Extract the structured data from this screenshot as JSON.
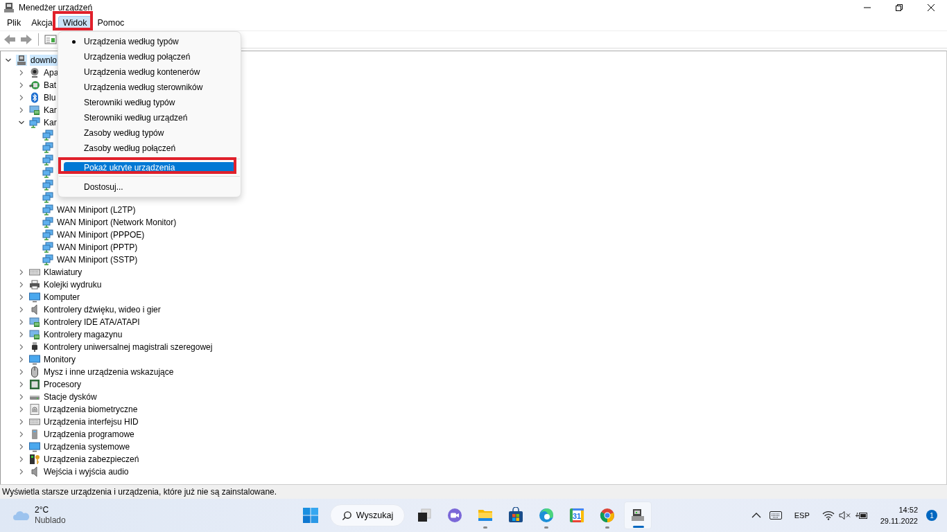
{
  "window": {
    "title": "Menedżer urządzeń"
  },
  "menubar": [
    {
      "label": "Plik",
      "selected": false,
      "marked_red": false
    },
    {
      "label": "Akcja",
      "selected": false,
      "marked_red": false
    },
    {
      "label": "Widok",
      "selected": true,
      "marked_red": true
    },
    {
      "label": "Pomoc",
      "selected": false,
      "marked_red": false
    }
  ],
  "view_menu": [
    {
      "kind": "option",
      "label": "Urządzenia według typów",
      "checked": true,
      "hovered": false,
      "marked_red": false
    },
    {
      "kind": "option",
      "label": "Urządzenia według połączeń",
      "checked": false,
      "hovered": false,
      "marked_red": false
    },
    {
      "kind": "option",
      "label": "Urządzenia według kontenerów",
      "checked": false,
      "hovered": false,
      "marked_red": false
    },
    {
      "kind": "option",
      "label": "Urządzenia według sterowników",
      "checked": false,
      "hovered": false,
      "marked_red": false
    },
    {
      "kind": "option",
      "label": "Sterowniki według typów",
      "checked": false,
      "hovered": false,
      "marked_red": false
    },
    {
      "kind": "option",
      "label": "Sterowniki według urządzeń",
      "checked": false,
      "hovered": false,
      "marked_red": false
    },
    {
      "kind": "option",
      "label": "Zasoby według typów",
      "checked": false,
      "hovered": false,
      "marked_red": false
    },
    {
      "kind": "option",
      "label": "Zasoby według połączeń",
      "checked": false,
      "hovered": false,
      "marked_red": false
    },
    {
      "kind": "separator"
    },
    {
      "kind": "option",
      "label": "Pokaż ukryte urządzenia",
      "checked": false,
      "hovered": true,
      "marked_red": true
    },
    {
      "kind": "separator"
    },
    {
      "kind": "option",
      "label": "Dostosuj...",
      "checked": false,
      "hovered": false,
      "marked_red": false
    }
  ],
  "tree": {
    "label": "downlo",
    "kind": "computer",
    "expanded": true,
    "selected": true,
    "children": [
      {
        "label": "Apa",
        "kind": "camera",
        "expanded": false,
        "selected": false
      },
      {
        "label": "Bat",
        "kind": "battery",
        "expanded": false,
        "selected": false
      },
      {
        "label": "Blu",
        "kind": "bluetooth",
        "expanded": false,
        "selected": false
      },
      {
        "label": "Kar",
        "kind": "card",
        "expanded": false,
        "selected": false
      },
      {
        "label": "Kar",
        "kind": "network",
        "expanded": true,
        "selected": false,
        "children": [
          {
            "kind": "network",
            "selected": false
          },
          {
            "kind": "network",
            "selected": false
          },
          {
            "kind": "network",
            "selected": false
          },
          {
            "kind": "network",
            "selected": false
          },
          {
            "kind": "network",
            "selected": false
          },
          {
            "kind": "network",
            "selected": false
          },
          {
            "label": "WAN Miniport (L2TP)",
            "kind": "network",
            "selected": false
          },
          {
            "label": "WAN Miniport (Network Monitor)",
            "kind": "network",
            "selected": false
          },
          {
            "label": "WAN Miniport (PPPOE)",
            "kind": "network",
            "selected": false
          },
          {
            "label": "WAN Miniport (PPTP)",
            "kind": "network",
            "selected": false
          },
          {
            "label": "WAN Miniport (SSTP)",
            "kind": "network",
            "selected": false
          }
        ]
      },
      {
        "label": "Klawiatury",
        "kind": "keyboard",
        "expanded": false,
        "selected": false
      },
      {
        "label": "Kolejki wydruku",
        "kind": "printer",
        "expanded": false,
        "selected": false
      },
      {
        "label": "Komputer",
        "kind": "monitor",
        "expanded": false,
        "selected": false
      },
      {
        "label": "Kontrolery dźwięku, wideo i gier",
        "kind": "speaker",
        "expanded": false,
        "selected": false
      },
      {
        "label": "Kontrolery IDE ATA/ATAPI",
        "kind": "card",
        "expanded": false,
        "selected": false
      },
      {
        "label": "Kontrolery magazynu",
        "kind": "card",
        "expanded": false,
        "selected": false
      },
      {
        "label": "Kontrolery uniwersalnej magistrali szeregowej",
        "kind": "usb",
        "expanded": false,
        "selected": false
      },
      {
        "label": "Monitory",
        "kind": "monitor",
        "expanded": false,
        "selected": false
      },
      {
        "label": "Mysz i inne urządzenia wskazujące",
        "kind": "mouse",
        "expanded": false,
        "selected": false
      },
      {
        "label": "Procesory",
        "kind": "cpu",
        "expanded": false,
        "selected": false
      },
      {
        "label": "Stacje dysków",
        "kind": "disk",
        "expanded": false,
        "selected": false
      },
      {
        "label": "Urządzenia biometryczne",
        "kind": "fingerprint",
        "expanded": false,
        "selected": false
      },
      {
        "label": "Urządzenia interfejsu HID",
        "kind": "keyboard",
        "expanded": false,
        "selected": false
      },
      {
        "label": "Urządzenia programowe",
        "kind": "tower",
        "expanded": false,
        "selected": false
      },
      {
        "label": "Urządzenia systemowe",
        "kind": "monitor",
        "expanded": false,
        "selected": false
      },
      {
        "label": "Urządzenia zabezpieczeń",
        "kind": "key",
        "expanded": false,
        "selected": false
      },
      {
        "label": "Wejścia i wyjścia audio",
        "kind": "speaker",
        "expanded": false,
        "selected": false
      }
    ]
  },
  "status_bar": "Wyświetla starsze urządzenia i urządzenia, które już nie są zainstalowane.",
  "taskbar": {
    "weather": {
      "temperature": "2°C",
      "condition": "Nublado"
    },
    "search_label": "Wyszukaj",
    "apps": [
      {
        "kind": "taskview",
        "running": false,
        "active": false
      },
      {
        "kind": "chat",
        "running": false,
        "active": false
      },
      {
        "kind": "folder",
        "running": true,
        "active": false
      },
      {
        "kind": "store",
        "running": false,
        "active": false
      },
      {
        "kind": "edge",
        "running": true,
        "active": false
      },
      {
        "kind": "calendar",
        "label": "31",
        "running": false,
        "active": false
      },
      {
        "kind": "chrome",
        "running": true,
        "active": false
      },
      {
        "kind": "devmgr",
        "running": true,
        "active": true
      }
    ],
    "language": "ESP",
    "time": "14:52",
    "date": "29.11.2022",
    "notifications": "1"
  }
}
